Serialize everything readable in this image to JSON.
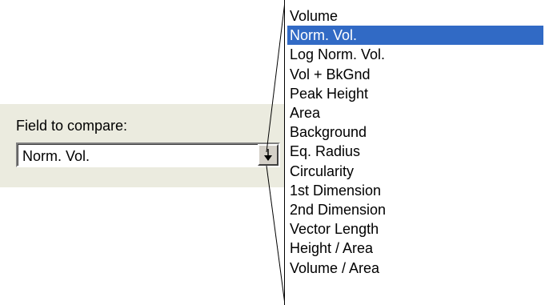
{
  "field": {
    "label": "Field to compare:",
    "value": "Norm. Vol."
  },
  "dropdown": {
    "selected_index": 1,
    "colors": {
      "selected_bg": "#316ac5",
      "selected_fg": "#ffffff"
    },
    "options": [
      "Volume",
      "Norm. Vol.",
      "Log Norm. Vol.",
      "Vol + BkGnd",
      "Peak Height",
      "Area",
      "Background",
      "Eq. Radius",
      "Circularity",
      "1st Dimension",
      "2nd Dimension",
      "Vector Length",
      "Height / Area",
      "Volume / Area"
    ]
  },
  "icons": {
    "combo_button": "down-arrow-icon"
  }
}
